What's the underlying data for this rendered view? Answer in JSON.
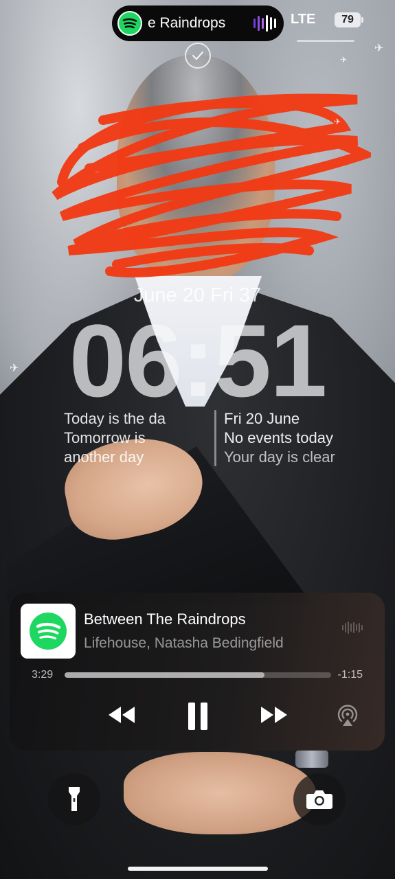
{
  "status_bar": {
    "now_playing_title": "e Raindrops",
    "network": "LTE",
    "battery": "79",
    "wave_colors": [
      "#6b3fd9",
      "#8a4fe0",
      "#b064e8",
      "#ffffff",
      "#ffffff",
      "#ffffff"
    ]
  },
  "lock_screen": {
    "date_line": "June 20 Fri 37",
    "time": "06:51",
    "widget_left": {
      "line1": "Today is the da",
      "line2": "Tomorrow is",
      "line3": "another day"
    },
    "widget_right": {
      "date": "Fri 20 June",
      "events": "No events today",
      "note": "Your day is clear"
    }
  },
  "music_player": {
    "app_icon": "spotify-icon",
    "track_title": "Between The Raindrops",
    "artist": "Lifehouse, Natasha Bedingfield",
    "elapsed": "3:29",
    "remaining": "-1:15",
    "progress_fraction": 0.75,
    "brand_color": "#1ed760",
    "controls": [
      "rewind-icon",
      "pause-icon",
      "fast-forward-icon",
      "airplay-icon"
    ]
  },
  "quick_actions": [
    "flashlight-icon",
    "camera-icon"
  ]
}
